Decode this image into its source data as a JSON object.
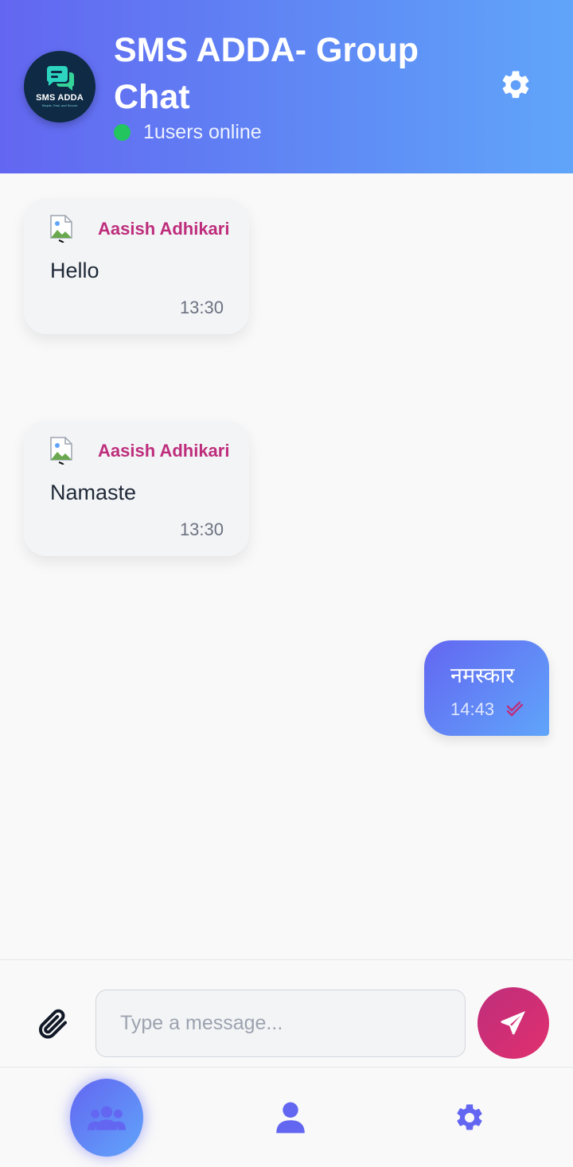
{
  "header": {
    "logo_text": "SMS ADDA",
    "logo_tagline": "Simple, Fast, and Secure",
    "title": "SMS ADDA- Group Chat",
    "online_text": "1users online"
  },
  "messages": [
    {
      "direction": "incoming",
      "sender": "Aasish Adhikari",
      "text": "Hello",
      "time": "13:30"
    },
    {
      "direction": "incoming",
      "sender": "Aasish Adhikari",
      "text": "Namaste",
      "time": "13:30"
    },
    {
      "direction": "outgoing",
      "text": "नमस्कार",
      "time": "14:43",
      "status": "read"
    }
  ],
  "composer": {
    "placeholder": "Type a message...",
    "value": ""
  },
  "colors": {
    "header_gradient_start": "#6366f1",
    "header_gradient_end": "#60a5fa",
    "sender_name": "#be2d7c",
    "online_dot": "#22c55e",
    "send_button": "#be2d7c",
    "nav_icon": "#6366f1"
  },
  "icons": {
    "settings": "gear-icon",
    "attach": "paperclip-icon",
    "send": "paper-plane-icon",
    "group_chat": "users-icon",
    "profile": "user-icon",
    "read_receipt": "double-check-icon"
  },
  "nav": {
    "items": [
      "group-chat",
      "profile",
      "settings"
    ],
    "active": "group-chat"
  }
}
